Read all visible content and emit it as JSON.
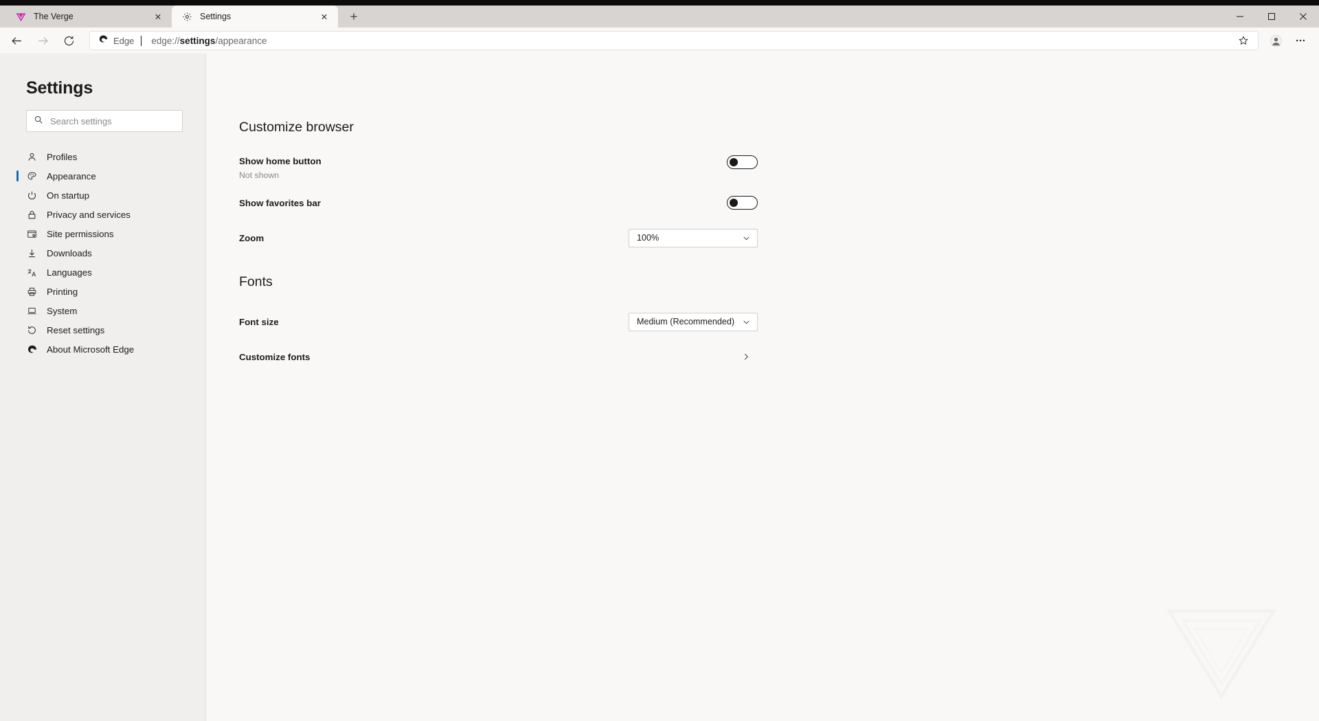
{
  "window": {
    "controls": [
      {
        "name": "minimize",
        "glyph": "—"
      },
      {
        "name": "maximize",
        "glyph": "☐"
      },
      {
        "name": "close",
        "glyph": "✕"
      }
    ]
  },
  "tabstrip": {
    "tabs": [
      {
        "title": "The Verge",
        "favicon": "verge-logo-icon",
        "active": false,
        "close_label": "✕"
      },
      {
        "title": "Settings",
        "favicon": "gear-icon",
        "active": true,
        "close_label": "✕"
      }
    ],
    "new_tab_label": "+"
  },
  "toolbar": {
    "back_label": "←",
    "forward_label": "→",
    "refresh_label": "↻",
    "brand_label": "Edge",
    "url_prefix": "edge://",
    "url_emphasis": "settings",
    "url_suffix": "/appearance",
    "url_full": "edge://settings/appearance",
    "star_label": "☆",
    "collections_label": "collections-icon",
    "more_label": "···"
  },
  "sidebar": {
    "title": "Settings",
    "search": {
      "placeholder": "Search settings",
      "value": ""
    },
    "items": [
      {
        "label": "Profiles",
        "icon": "person-icon",
        "selected": false
      },
      {
        "label": "Appearance",
        "icon": "palette-icon",
        "selected": true
      },
      {
        "label": "On startup",
        "icon": "power-icon",
        "selected": false
      },
      {
        "label": "Privacy and services",
        "icon": "lock-icon",
        "selected": false
      },
      {
        "label": "Site permissions",
        "icon": "site-permissions-icon",
        "selected": false
      },
      {
        "label": "Downloads",
        "icon": "download-arrow-icon",
        "selected": false
      },
      {
        "label": "Languages",
        "icon": "languages-icon",
        "selected": false
      },
      {
        "label": "Printing",
        "icon": "printer-icon",
        "selected": false
      },
      {
        "label": "System",
        "icon": "laptop-icon",
        "selected": false
      },
      {
        "label": "Reset settings",
        "icon": "reset-circle-icon",
        "selected": false
      },
      {
        "label": "About Microsoft Edge",
        "icon": "edge-logo-icon",
        "selected": false
      }
    ]
  },
  "main": {
    "section_customize": {
      "heading": "Customize browser",
      "rows": [
        {
          "label": "Show home button",
          "sublabel": "Not shown",
          "control": "toggle",
          "state": "off"
        },
        {
          "label": "Show favorites bar",
          "sublabel": "",
          "control": "toggle",
          "state": "off"
        },
        {
          "label": "Zoom",
          "sublabel": "",
          "control": "dropdown",
          "value": "100%"
        }
      ]
    },
    "section_fonts": {
      "heading": "Fonts",
      "rows": [
        {
          "label": "Font size",
          "sublabel": "",
          "control": "dropdown",
          "value": "Medium (Recommended)"
        },
        {
          "label": "Customize fonts",
          "sublabel": "",
          "control": "chevron",
          "value": "›"
        }
      ]
    }
  },
  "colors": {
    "accent": "#0f6cbd",
    "sidebar_bg": "#f0efee",
    "content_bg": "#f9f8f7",
    "titlebar_bg": "#d8d4d1",
    "text": "#1b1b1b",
    "muted_text": "#8a8886",
    "verge_purple": "#e01e5a"
  }
}
